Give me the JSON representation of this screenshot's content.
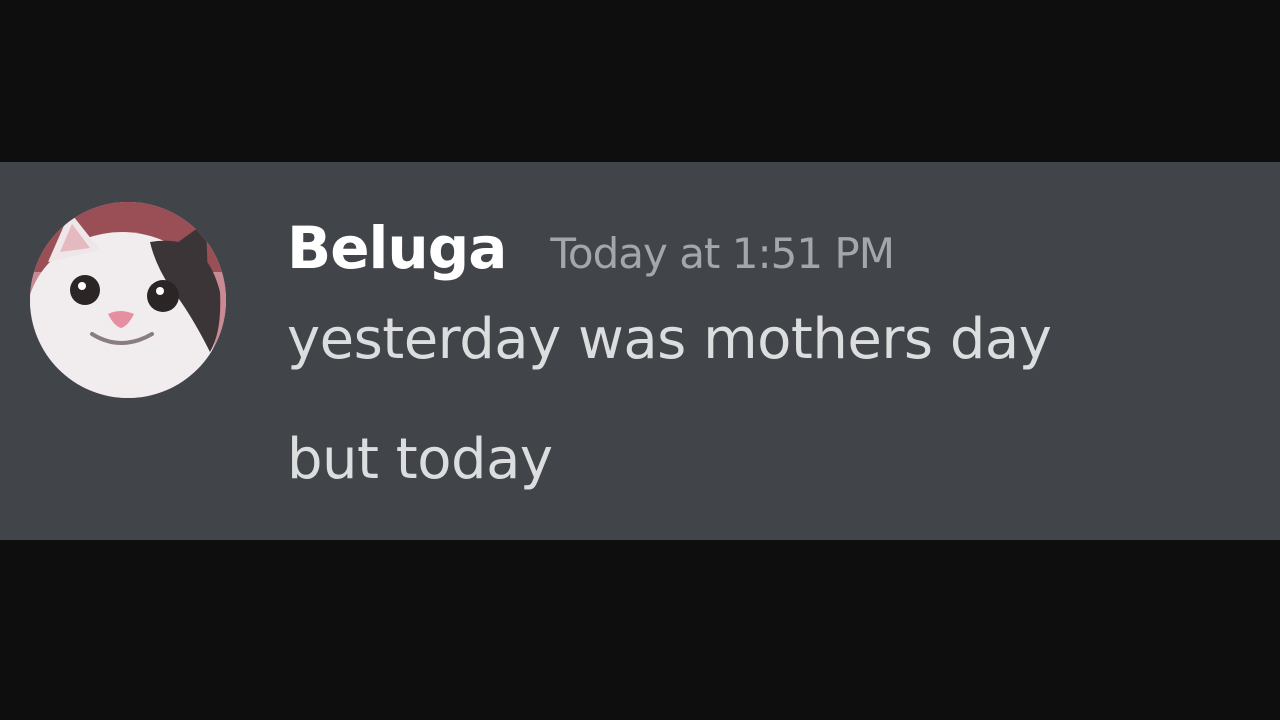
{
  "message": {
    "username": "Beluga",
    "timestamp": "Today at 1:51 PM",
    "lines": [
      "yesterday was mothers day",
      "but today"
    ]
  },
  "colors": {
    "message_background": "#414449",
    "letterbox": "#0e0e0f",
    "username": "#ffffff",
    "timestamp": "#a3a6aa",
    "content": "#dcddde"
  },
  "icons": {
    "avatar": "cat-avatar-icon"
  }
}
